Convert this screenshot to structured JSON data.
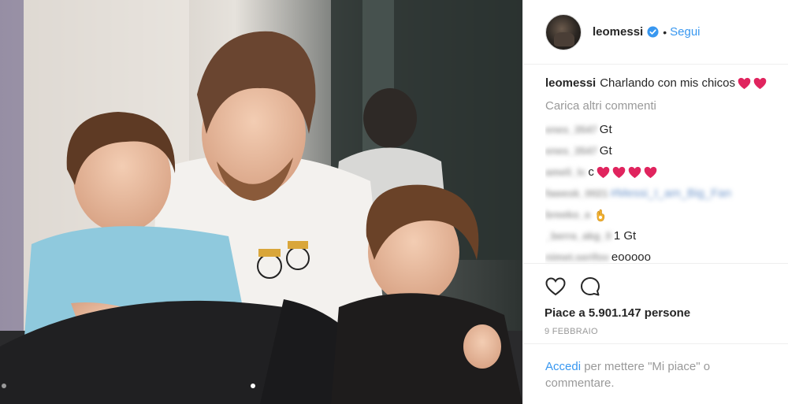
{
  "header": {
    "username": "leomessi",
    "separator": "•",
    "follow_label": "Segui"
  },
  "caption": {
    "username": "leomessi",
    "text": "Charlando con mis chicos"
  },
  "load_more_label": "Carica altri commenti",
  "comments": [
    {
      "user": "enes_3547",
      "text": "Gt",
      "blurred_text": false
    },
    {
      "user": "enes_3547",
      "text": "Gt",
      "blurred_text": false
    },
    {
      "user": "ameli_lc",
      "text": "c",
      "blurred_text": false
    },
    {
      "user": "fawesk_0021",
      "text": "#Messi_I_am_Big_Fan",
      "blurred_text": true
    },
    {
      "user": "breeko_a",
      "text": "",
      "blurred_text": false
    },
    {
      "user": "_berra_akg_0",
      "text": "1 Gt",
      "blurred_text": false
    },
    {
      "user": "nimet.serifov",
      "text": "eooooo",
      "blurred_text": false
    }
  ],
  "likes_text": "Piace a 5.901.147 persone",
  "date_text": "9 FEBBRAIO",
  "footer": {
    "login_link": "Accedi",
    "rest": " per mettere \"Mi piace\" o commentare."
  },
  "icons": {
    "heart": "heart-icon",
    "comment": "comment-icon",
    "verified": "verified-badge-icon"
  },
  "colors": {
    "link": "#3897f0",
    "heart_emoji": "#e0245e",
    "muted": "#999999"
  }
}
